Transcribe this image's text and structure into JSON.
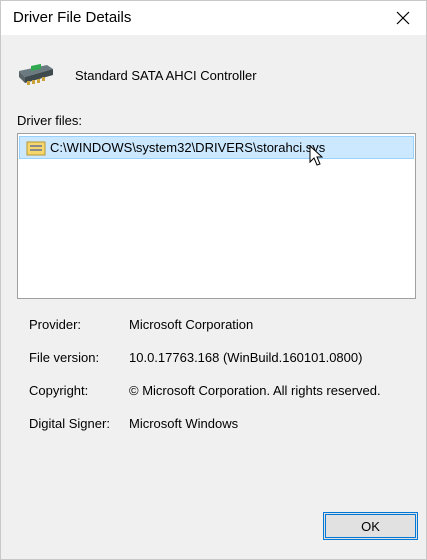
{
  "window": {
    "title": "Driver File Details"
  },
  "device": {
    "name": "Standard SATA AHCI Controller",
    "icon": "storage-controller-icon"
  },
  "driver_files": {
    "label": "Driver files:",
    "items": [
      {
        "path": "C:\\WINDOWS\\system32\\DRIVERS\\storahci.sys",
        "icon": "driver-file-icon",
        "selected": true
      }
    ]
  },
  "properties": {
    "provider_label": "Provider:",
    "provider_value": "Microsoft Corporation",
    "version_label": "File version:",
    "version_value": "10.0.17763.168 (WinBuild.160101.0800)",
    "copyright_label": "Copyright:",
    "copyright_value": "© Microsoft Corporation. All rights reserved.",
    "signer_label": "Digital Signer:",
    "signer_value": "Microsoft Windows"
  },
  "buttons": {
    "ok_label": "OK"
  },
  "colors": {
    "selection_bg": "#cce8ff",
    "accent": "#0078d7"
  }
}
